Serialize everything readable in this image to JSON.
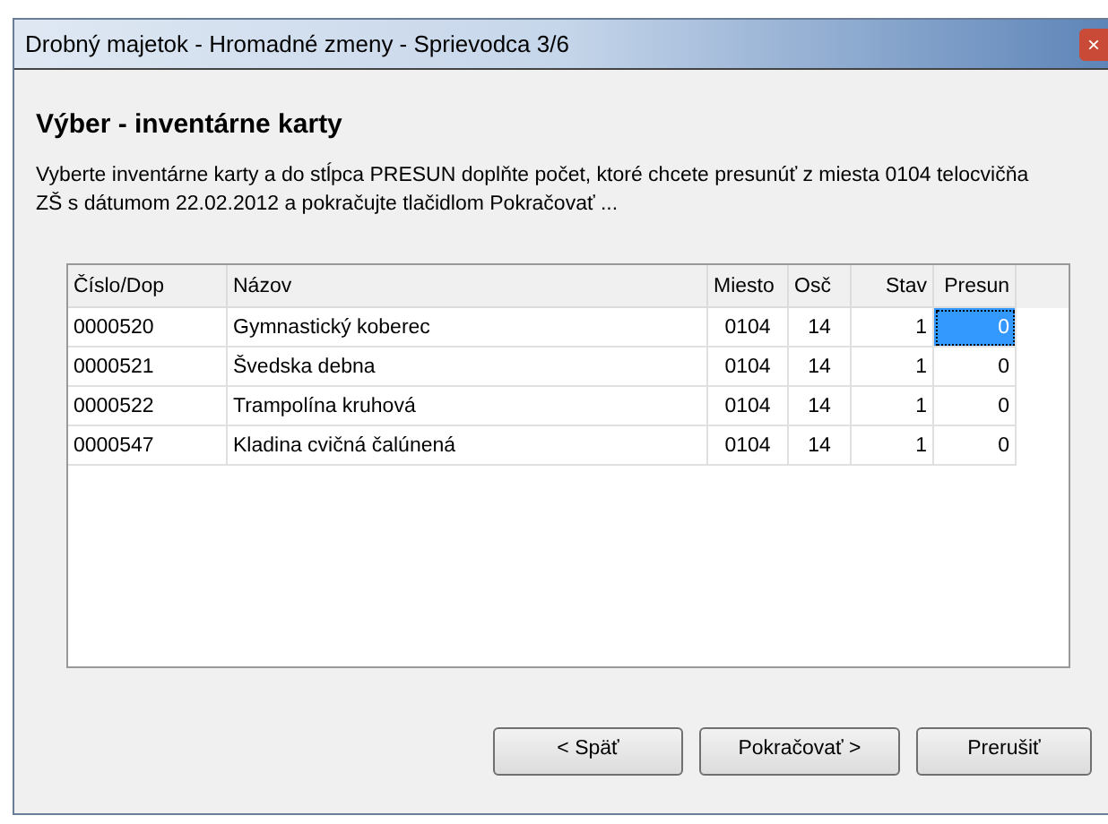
{
  "window": {
    "title": "Drobný majetok - Hromadné zmeny - Sprievodca 3/6",
    "close": "×"
  },
  "heading": "Výber - inventárne karty",
  "description": "Vyberte inventárne karty a do stĺpca PRESUN doplňte počet, ktoré chcete presunúť z miesta 0104 telocvičňa ZŠ s dátumom 22.02.2012 a pokračujte tlačidlom Pokračovať ...",
  "table": {
    "columns": [
      "Číslo/Dop",
      "Názov",
      "Miesto",
      "Osč",
      "Stav",
      "Presun"
    ],
    "rows": [
      {
        "cells": [
          "0000520",
          "Gymnastický koberec",
          "0104",
          "14",
          "1",
          "0"
        ],
        "selected": true
      },
      {
        "cells": [
          "0000521",
          "Švedska debna",
          "0104",
          "14",
          "1",
          "0"
        ],
        "selected": false
      },
      {
        "cells": [
          "0000522",
          "Trampolína kruhová",
          "0104",
          "14",
          "1",
          "0"
        ],
        "selected": false
      },
      {
        "cells": [
          "0000547",
          "Kladina cvičná čalúnená",
          "0104",
          "14",
          "1",
          "0"
        ],
        "selected": false
      }
    ]
  },
  "buttons": [
    "< Späť",
    "Pokračovať >",
    "Prerušiť"
  ]
}
